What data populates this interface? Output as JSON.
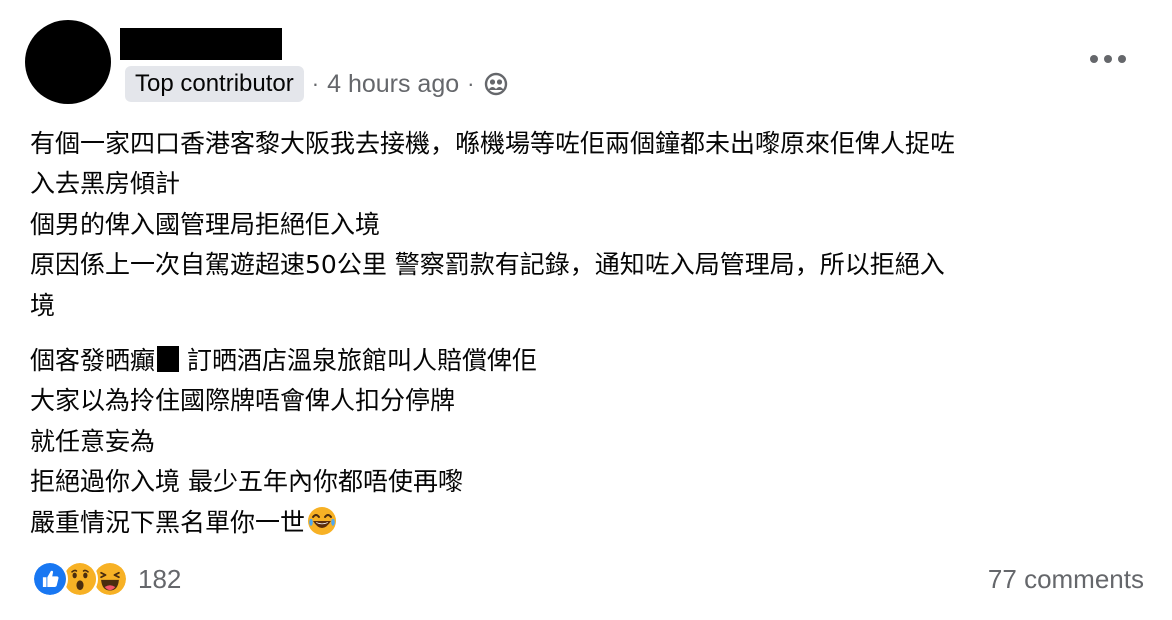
{
  "author": {
    "name_redacted": true,
    "badge": "Top contributor",
    "separator": "·",
    "timestamp": "4 hours ago",
    "audience_icon": "friends-icon"
  },
  "post": {
    "paragraphs": [
      {
        "lines": [
          "有個一家四口香港客黎大阪我去接機，喺機場等咗佢兩個鐘都未出嚟原來佢俾人捉咗",
          "入去黑房傾計",
          "個男的俾入國管理局拒絕佢入境",
          "原因係上一次自駕遊超速50公里 警察罰款有記錄，通知咗入局管理局，所以拒絕入",
          "境"
        ]
      },
      {
        "lines": [
          "個客發晒癲",
          " 訂晒酒店溫泉旅館叫人賠償俾佢",
          "大家以為拎住國際牌唔會俾人扣分停牌",
          "就任意妄為",
          "拒絕過你入境 最少五年內你都唔使再嚟",
          "嚴重情況下黑名單你一世"
        ]
      }
    ],
    "trailing_emoji": "tears-of-joy-emoji"
  },
  "footer": {
    "reactions": [
      "like-icon",
      "wow-icon",
      "haha-icon"
    ],
    "reaction_count": "182",
    "comments": "77 comments"
  },
  "colors": {
    "text": "#050505",
    "secondary": "#65676b",
    "badge_bg": "#e4e6eb",
    "like_blue": "#1877f2",
    "emoji_yellow": "#f7b125"
  }
}
